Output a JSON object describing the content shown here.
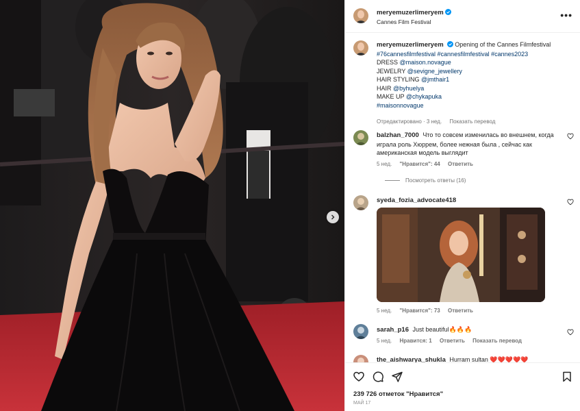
{
  "post": {
    "author": "meryemuzerlimeryem",
    "location": "Cannes Film Festival",
    "more_icon": "more-options-icon",
    "next_icon": "chevron-right-icon"
  },
  "caption": {
    "username": "meryemuzerlimeryem",
    "lines": [
      "Opening of the Cannes Filmfestival",
      "#76cannesfilmfestival #cannesfilmfestival #cannes2023",
      "DRESS",
      "@maison.novague",
      "JEWELRY",
      "@sevigne_jewellery",
      "HAIR STYLING",
      "@jmthair1",
      "HAIR",
      "@byhuelya",
      "MAKE UP",
      "@chykapuka",
      "#maisonnovague"
    ],
    "meta_edited": "Отредактировано · 3 нед.",
    "meta_translate": "Показать перевод"
  },
  "comments": [
    {
      "username": "balzhan_7000",
      "text": "Что то совсем изменилась во внешнем, когда играла роль Хюррем, более нежная была , сейчас как американская модель выглядит",
      "time": "5 нед.",
      "likes": "\"Нравится\": 44",
      "reply": "Ответить",
      "view_replies": "Посмотреть ответы (16)"
    },
    {
      "username": "syeda_fozia_advocate418",
      "text": "",
      "time": "5 нед.",
      "likes": "\"Нравится\": 73",
      "reply": "Ответить"
    },
    {
      "username": "sarah_p16",
      "text": "Just beautiful🔥🔥🔥",
      "time": "5 нед.",
      "likes": "Нравится: 1",
      "reply": "Ответить",
      "translate": "Показать перевод"
    },
    {
      "username": "the_aishwarya_shukla",
      "text": "Hurram sultan ❤️❤️❤️❤️❤️"
    }
  ],
  "actions": {
    "like_icon": "heart-icon",
    "comment_icon": "comment-icon",
    "share_icon": "share-icon",
    "save_icon": "bookmark-icon",
    "likes_count": "239 726 отметок \"Нравится\"",
    "date": "МАЙ 17"
  },
  "colors": {
    "link": "#00376b",
    "verified": "#0095f6",
    "meta": "#737373",
    "carpet": "#b8282f",
    "dress": "#0c0a0b"
  }
}
